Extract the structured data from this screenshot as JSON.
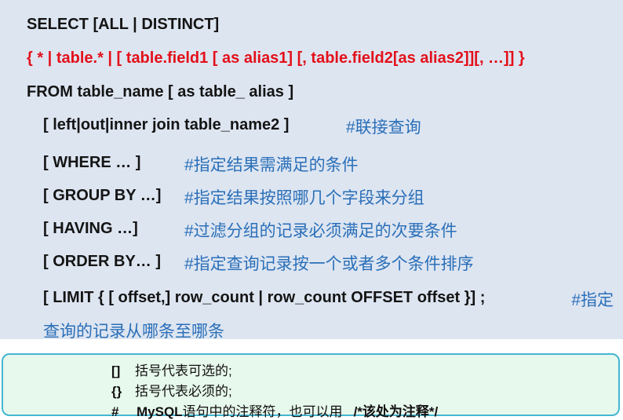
{
  "syntax": {
    "select_line": "SELECT    [ALL | DISTINCT]",
    "fields_line": "{  *  |   table.*  | [ table.field1 [ as  alias1] [, table.field2[as  alias2]][, …]] }",
    "from_line": "FROM  table_name  [ as  table_ alias  ]",
    "join": {
      "code": "[ left|out|inner  join  table_name2 ]",
      "comment": "#联接查询"
    },
    "where": {
      "code": "[ WHERE  … ]",
      "comment": "#指定结果需满足的条件"
    },
    "group_by": {
      "code": "[ GROUP BY …]",
      "comment": "#指定结果按照哪几个字段来分组"
    },
    "having": {
      "code": "[ HAVING …]",
      "comment": "#过滤分组的记录必须满足的次要条件"
    },
    "order_by": {
      "code": "[ ORDER BY… ]",
      "comment": "#指定查询记录按一个或者多个条件排序"
    },
    "limit": {
      "code": "[ LIMIT  {    [ offset,] row_count     |     row_count OFFSET offset     }] ;",
      "comment_line1": "#指定",
      "comment_line2": "查询的记录从哪条至哪条"
    }
  },
  "legend": [
    {
      "symbol": "[]",
      "text": "括号代表可选的;"
    },
    {
      "symbol": "{}",
      "text": "括号代表必须的;"
    },
    {
      "symbol": "#",
      "text_bold_part": "MySQL",
      "text": "语句中的注释符，也可以用",
      "example": "/*该处为注释*/"
    }
  ],
  "colors": {
    "panel_bg": "#dde5f1",
    "red_text": "#e3101a",
    "comment_blue": "#2a6fb8",
    "legend_bg": "#e7f8ec",
    "legend_border": "#45b6d2"
  }
}
